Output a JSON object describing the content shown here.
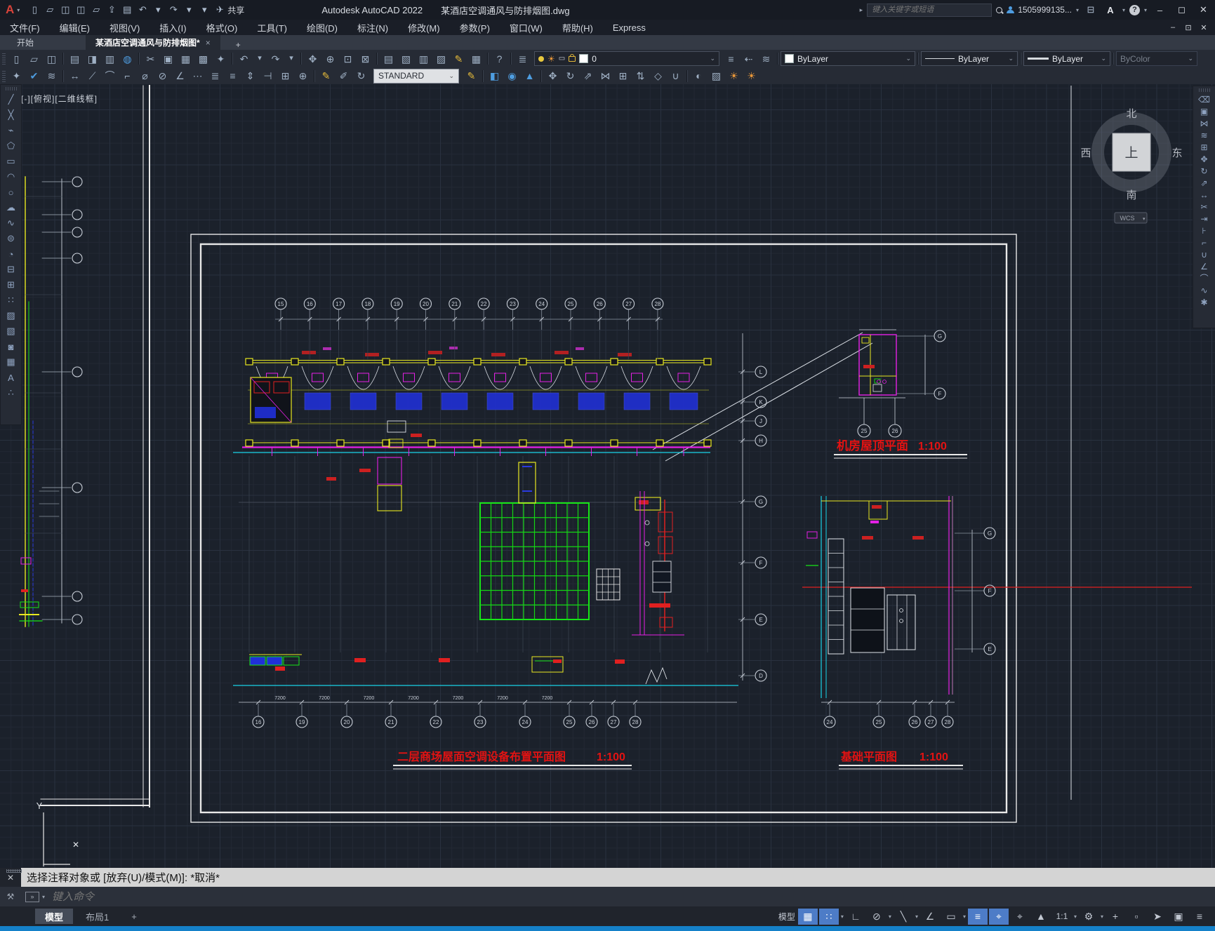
{
  "titlebar": {
    "app_title": "Autodesk AutoCAD 2022",
    "doc_title": "某酒店空调通风与防排烟图.dwg",
    "share_label": "共享",
    "search_placeholder": "键入关键字或短语",
    "account_id": "1505999135...",
    "quick_access_icons": [
      "new-file",
      "open-file",
      "save",
      "save-as",
      "open-from-mobile",
      "upload-to-mobile",
      "print",
      "undo",
      "undo-dropdown",
      "redo",
      "redo-dropdown",
      "toolbar-dropdown"
    ]
  },
  "menubar": [
    "文件(F)",
    "编辑(E)",
    "视图(V)",
    "插入(I)",
    "格式(O)",
    "工具(T)",
    "绘图(D)",
    "标注(N)",
    "修改(M)",
    "参数(P)",
    "窗口(W)",
    "帮助(H)",
    "Express"
  ],
  "file_tabs": {
    "start_tab": "开始",
    "active_tab": "某酒店空调通风与防排烟图*",
    "close_glyph": "×",
    "new_tab": "+"
  },
  "toolbars": {
    "row1_icons": [
      "new-file",
      "open-file",
      "save",
      "div",
      "plot",
      "plot-preview",
      "batch-plot",
      "publish-web",
      "div",
      "cut",
      "copy",
      "paste",
      "paste-special",
      "match-properties",
      "div",
      "undo",
      "caret",
      "redo",
      "caret",
      "div",
      "pan",
      "zoom-realtime",
      "zoom-window",
      "zoom-previous",
      "div",
      "properties",
      "design-center",
      "tool-palettes",
      "sheet-set-manager",
      "markup-import",
      "quick-calc",
      "div",
      "help",
      "div",
      "layer-properties"
    ],
    "layer_state_icons": [
      "make-layer-current",
      "layer-previous",
      "layer-states"
    ],
    "row2_left_icons": [
      "match-properties",
      "annotation-update",
      "layer-translate",
      "div",
      "linear-dimension",
      "aligned-dimension",
      "arc-length-dimension",
      "ordinate-dimension",
      "radius-dimension",
      "diameter-dimension",
      "angular-dimension",
      "quick-dimension",
      "baseline-dimension",
      "continue-dimension",
      "dimension-space",
      "dimension-break",
      "tolerance",
      "center-mark",
      "div",
      "dimension-edit",
      "dimension-text-edit",
      "dimension-update"
    ],
    "row2_right_icons": [
      "dimension-style",
      "div",
      "solid-box",
      "solid-cylinder",
      "solid-cone",
      "div",
      "3d-move",
      "3d-rotate",
      "3d-align",
      "3d-mirror",
      "3d-array",
      "press-pull",
      "extract-edges",
      "union",
      "div",
      "render",
      "materials",
      "lights",
      "sun-status"
    ],
    "layer_value": "0",
    "color_value": "ByLayer",
    "linetype_value": "ByLayer",
    "lineweight_value": "ByLayer",
    "plot_style_value": "ByColor",
    "dim_style_value": "STANDARD"
  },
  "palettes": {
    "draw": [
      "line",
      "construction-line",
      "polyline",
      "polygon",
      "rectangle",
      "arc",
      "circle",
      "revision-cloud",
      "spline",
      "ellipse",
      "ellipse-arc",
      "insert-block",
      "create-block",
      "multiple-points",
      "hatch",
      "gradient",
      "region",
      "table",
      "multiline-text",
      "point-style"
    ],
    "modify": [
      "erase",
      "copy",
      "mirror",
      "offset",
      "array",
      "move",
      "rotate",
      "scale",
      "stretch",
      "trim",
      "extend",
      "break-at-point",
      "break",
      "join",
      "chamfer",
      "fillet",
      "blend-curves",
      "explode"
    ]
  },
  "canvas": {
    "viewport_label": "[-][俯视][二维线框]",
    "viewcube": {
      "north": "北",
      "south": "南",
      "west": "西",
      "east": "东",
      "top": "上",
      "wcs": "WCS"
    },
    "ucs": {
      "x_label": "✕",
      "y_label": "Y"
    },
    "left_strip": {
      "bubbles": [
        "",
        "",
        "",
        "",
        "",
        "",
        "",
        ""
      ]
    },
    "drawings": {
      "roof_plan": {
        "title": "机房屋顶平面",
        "scale": "1:100",
        "bottom_bubbles": [
          "25",
          "26"
        ],
        "right_bubbles": [
          "G",
          "F"
        ]
      },
      "main_plan": {
        "title": "二层商场屋面空调设备布置平面图",
        "scale": "1:100",
        "top_bubbles": [
          "15",
          "16",
          "17",
          "18",
          "19",
          "20",
          "21",
          "22",
          "23",
          "24",
          "25",
          "26",
          "27",
          "28"
        ],
        "bottom_bubbles": [
          "16",
          "19",
          "20",
          "21",
          "22",
          "23",
          "24",
          "25",
          "26",
          "27",
          "28"
        ],
        "right_bubbles": [
          "L",
          "K",
          "J",
          "H",
          "G",
          "F",
          "E",
          "D"
        ],
        "dim_label": "7200"
      },
      "foundation_plan": {
        "title": "基础平面图",
        "scale": "1:100",
        "bottom_bubbles": [
          "24",
          "25",
          "26",
          "27",
          "28"
        ],
        "right_bubbles": [
          "G",
          "F",
          "E"
        ]
      }
    }
  },
  "command_line": {
    "history": "选择注释对象或 [放弃(U)/模式(M)]: *取消*",
    "input_placeholder": "键入命令"
  },
  "layout_tabs": {
    "model": "模型",
    "layout1": "布局1",
    "add": "+"
  },
  "status_bar": {
    "items": [
      {
        "name": "model-space",
        "label": "模型"
      },
      {
        "name": "grid-display",
        "on": true
      },
      {
        "name": "snap-mode",
        "on": true,
        "caret": true
      },
      {
        "name": "ortho-mode"
      },
      {
        "name": "polar-tracking",
        "caret": true
      },
      {
        "name": "isometric-drafting",
        "caret": true
      },
      {
        "name": "object-snap-tracking"
      },
      {
        "name": "dynamic-input",
        "caret": true
      },
      {
        "name": "selection-cycling",
        "on": true
      },
      {
        "name": "object-snap",
        "on": true
      },
      {
        "name": "3d-object-snap"
      },
      {
        "name": "annotation-visibility"
      },
      {
        "name": "annotation-scale",
        "label": "1:1",
        "caret": true
      },
      {
        "name": "workspace-switching",
        "caret": true
      },
      {
        "name": "annotation-monitor"
      },
      {
        "name": "units"
      },
      {
        "name": "graphics-performance",
        "accent": true
      },
      {
        "name": "clean-screen"
      },
      {
        "name": "customize"
      }
    ]
  },
  "colors": {
    "accent_blue": "#1581c9",
    "highlight_blue": "#4d7cc7",
    "cad_yellow": "#e8e820",
    "cad_magenta": "#e520e5",
    "cad_green": "#17e517",
    "cad_cyan": "#19d2e8",
    "cad_red": "#e02020",
    "cad_blue": "#2233dd",
    "title_red": "#e31212"
  }
}
